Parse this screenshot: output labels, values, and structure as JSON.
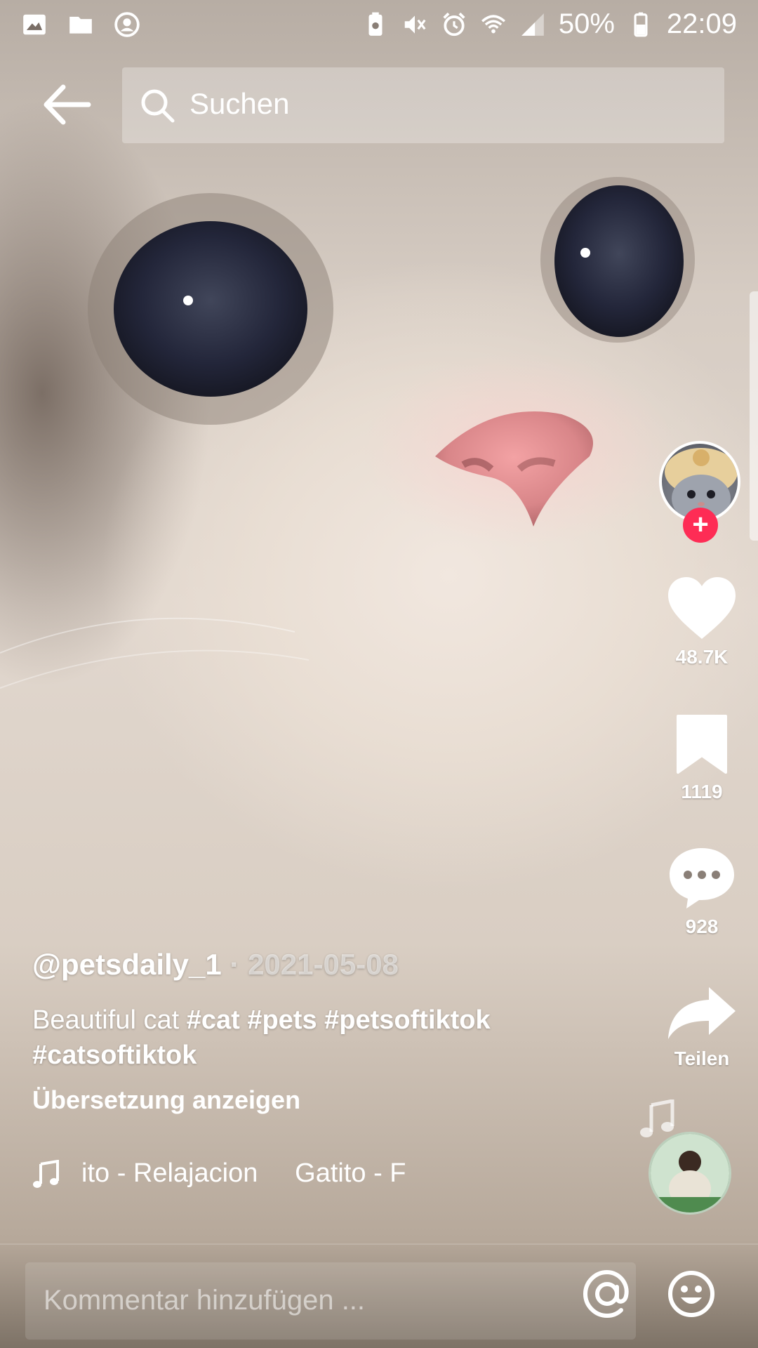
{
  "status_bar": {
    "battery_percent": "50%",
    "time": "22:09",
    "left_icons": [
      "image-icon",
      "folder-icon",
      "account-circle-icon"
    ],
    "right_icons": [
      "battery-saver-icon",
      "mute-icon",
      "alarm-icon",
      "wifi-icon",
      "signal-icon",
      "battery-icon"
    ]
  },
  "search": {
    "placeholder": "Suchen"
  },
  "actions": {
    "likes": "48.7K",
    "favorites": "1119",
    "comments": "928",
    "share_label": "Teilen",
    "follow_symbol": "+"
  },
  "post": {
    "author": "@petsdaily_1",
    "date": "· 2021-05-08",
    "description_text": "Beautiful cat ",
    "hashtags": [
      "#cat",
      "#pets",
      "#petsoftiktok",
      "#catsoftiktok"
    ],
    "translate_label": "Übersetzung anzeigen",
    "music_title": "ito - Relajacion     Gatito - F"
  },
  "comment_bar": {
    "placeholder": "Kommentar hinzufügen ..."
  },
  "colors": {
    "accent_red": "#fe2c55",
    "text_white": "#ffffff"
  }
}
